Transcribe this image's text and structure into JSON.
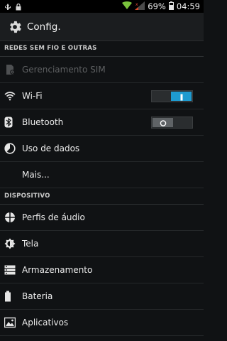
{
  "status": {
    "battery": "69%",
    "time": "04:59"
  },
  "header": {
    "title": "Config."
  },
  "sections": {
    "wireless": "REDES SEM FIO E OUTRAS",
    "device": "DISPOSITIVO"
  },
  "items": {
    "sim": "Gerenciamento SIM",
    "wifi": "Wi-Fi",
    "bluetooth": "Bluetooth",
    "data_usage": "Uso de dados",
    "more": "Mais...",
    "audio": "Perfis de áudio",
    "display": "Tela",
    "storage": "Armazenamento",
    "battery": "Bateria",
    "apps": "Aplicativos"
  },
  "toggles": {
    "wifi": "on",
    "bluetooth": "off"
  },
  "colors": {
    "accent": "#1e9bd0",
    "background": "#101214"
  }
}
